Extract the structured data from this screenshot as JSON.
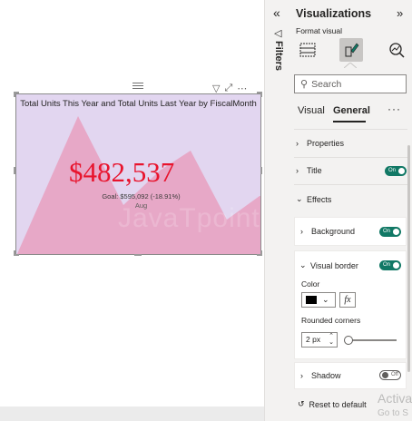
{
  "visual": {
    "title": "Total Units This Year and Total Units Last Year by FiscalMonth",
    "kpi_value": "$482,537",
    "goal_text": "Goal: $595,092 (-18.91%)",
    "month_label": "Aug",
    "watermark": "JavaTpoint"
  },
  "filters": {
    "label": "Filters"
  },
  "pane": {
    "title": "Visualizations",
    "format_visual": "Format visual",
    "search_placeholder": "Search",
    "tabs": [
      "Visual",
      "General"
    ],
    "active_tab": "General",
    "more": "···",
    "sections": {
      "properties": "Properties",
      "title": "Title",
      "effects": "Effects",
      "background": "Background",
      "visual_border": "Visual border",
      "shadow": "Shadow"
    },
    "toggles": {
      "title": "On",
      "background": "On",
      "visual_border": "On",
      "shadow": "Off"
    },
    "color_label": "Color",
    "color_value": "#000000",
    "fx_label": "fx",
    "rounded_label": "Rounded corners",
    "rounded_value": "2 px",
    "reset": "Reset to default"
  },
  "os_overlay": {
    "line1": "Activa",
    "line2": "Go to S"
  },
  "colors": {
    "kpi": "#e8142d",
    "area_fill": "#e8a0c0",
    "visual_bg": "#e2d6f0",
    "toggle_on": "#117865"
  }
}
